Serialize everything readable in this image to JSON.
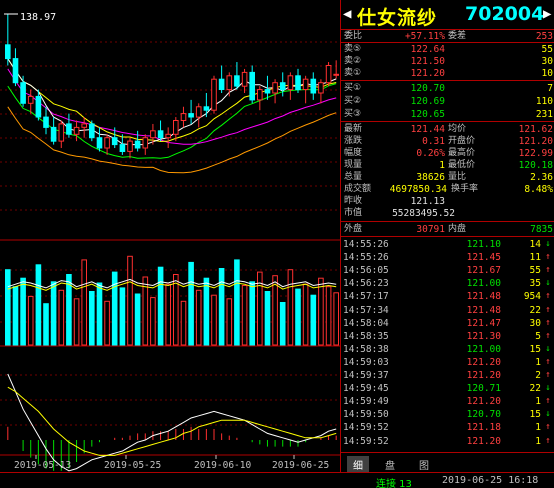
{
  "stock": {
    "name": "仕女流纱",
    "code": "702004"
  },
  "chart": {
    "high_label": "138.97",
    "x_labels": [
      "2019-05-13",
      "2019-05-25",
      "2019-06-10",
      "2019-06-25"
    ],
    "colors": {
      "up": "#ff3030",
      "down": "#00ffff",
      "ma5": "#ffffff",
      "ma10": "#ffff00",
      "ma20": "#ff00ff",
      "ma60": "#00ff00",
      "ma120": "#ff9900"
    }
  },
  "chart_data": {
    "type": "candlestick",
    "x_ticks": [
      "2019-05-13",
      "2019-05-25",
      "2019-06-10",
      "2019-06-25"
    ],
    "high_marker": 138.97,
    "candles": [
      [
        130,
        138.97,
        124,
        126
      ],
      [
        126,
        129,
        118,
        119
      ],
      [
        119,
        121,
        112,
        113
      ],
      [
        113,
        117,
        110,
        115
      ],
      [
        115,
        117,
        108,
        109
      ],
      [
        109,
        112,
        104,
        106
      ],
      [
        106,
        109,
        101,
        102
      ],
      [
        102,
        108,
        100,
        107
      ],
      [
        107,
        110,
        103,
        104
      ],
      [
        104,
        108,
        102,
        106
      ],
      [
        106,
        109,
        103,
        107
      ],
      [
        107,
        108,
        102,
        103
      ],
      [
        103,
        106,
        99,
        100
      ],
      [
        100,
        104,
        98,
        103
      ],
      [
        103,
        106,
        100,
        101
      ],
      [
        101,
        104,
        98,
        99
      ],
      [
        99,
        103,
        97,
        102
      ],
      [
        102,
        105,
        99,
        100
      ],
      [
        100,
        104,
        98,
        103
      ],
      [
        103,
        107,
        101,
        105
      ],
      [
        105,
        108,
        102,
        103
      ],
      [
        103,
        106,
        100,
        104
      ],
      [
        104,
        109,
        102,
        108
      ],
      [
        108,
        112,
        106,
        110
      ],
      [
        110,
        114,
        107,
        109
      ],
      [
        109,
        113,
        106,
        112
      ],
      [
        112,
        116,
        109,
        111
      ],
      [
        111,
        121,
        110,
        120
      ],
      [
        120,
        124,
        116,
        117
      ],
      [
        117,
        122,
        115,
        121
      ],
      [
        121,
        125,
        117,
        118
      ],
      [
        118,
        123,
        116,
        122
      ],
      [
        122,
        124,
        113,
        114
      ],
      [
        114,
        118,
        111,
        117
      ],
      [
        117,
        121,
        114,
        116
      ],
      [
        116,
        120,
        113,
        119
      ],
      [
        119,
        122,
        115,
        117
      ],
      [
        117,
        122,
        114,
        121
      ],
      [
        121,
        123,
        116,
        117
      ],
      [
        117,
        121,
        113,
        120
      ],
      [
        120,
        122,
        114,
        116
      ],
      [
        116,
        120,
        113,
        119
      ],
      [
        119,
        125,
        118,
        124
      ],
      [
        121.2,
        125.5,
        120.2,
        121.44
      ]
    ],
    "volumes": [
      62,
      48,
      55,
      40,
      66,
      34,
      52,
      45,
      58,
      38,
      70,
      44,
      51,
      36,
      60,
      47,
      73,
      42,
      56,
      39,
      64,
      50,
      58,
      36,
      68,
      45,
      55,
      41,
      63,
      38,
      70,
      49,
      52,
      60,
      44,
      57,
      35,
      62,
      46,
      50,
      41,
      55,
      48,
      43
    ],
    "volume_ma5": [
      48,
      50,
      52,
      51,
      49,
      47,
      50,
      53,
      52,
      48,
      50,
      52,
      49,
      47,
      50,
      52,
      54,
      51,
      50,
      49,
      52,
      51,
      53,
      50,
      52,
      50,
      51,
      49,
      52,
      50,
      53,
      52,
      50,
      51,
      49,
      52,
      48,
      50,
      51,
      52,
      49,
      50,
      51,
      50
    ],
    "macd_dif": [
      30,
      22,
      14,
      8,
      2,
      -4,
      -9,
      -12,
      -14,
      -13,
      -11,
      -9,
      -8,
      -7,
      -6,
      -5,
      -3,
      -1,
      0,
      2,
      3,
      4,
      6,
      8,
      10,
      11,
      12,
      13,
      12,
      11,
      10,
      9,
      7,
      5,
      3,
      2,
      1,
      0,
      -1,
      0,
      1,
      2,
      4,
      5
    ],
    "macd_dea": [
      24,
      22,
      19,
      16,
      13,
      9,
      5,
      2,
      -1,
      -3,
      -5,
      -6,
      -7,
      -7,
      -7,
      -6,
      -5,
      -4,
      -3,
      -2,
      -1,
      0,
      1,
      3,
      4,
      6,
      7,
      8,
      9,
      9,
      9,
      9,
      8,
      7,
      6,
      5,
      4,
      3,
      2,
      1,
      1,
      1,
      2,
      3
    ],
    "macd_bar": [
      6,
      0,
      -5,
      -8,
      -11,
      -13,
      -14,
      -14,
      -13,
      -10,
      -6,
      -3,
      -1,
      0,
      1,
      1,
      2,
      3,
      3,
      4,
      4,
      4,
      5,
      5,
      6,
      5,
      5,
      5,
      3,
      2,
      1,
      0,
      -1,
      -2,
      -3,
      -3,
      -3,
      -3,
      -3,
      -1,
      0,
      1,
      2,
      2
    ]
  },
  "quote": {
    "weibi_label": "委比",
    "weibi": "+57.11%",
    "weicha_label": "委差",
    "weicha": "253",
    "sells": [
      {
        "label": "卖⑤",
        "price": "122.64",
        "vol": "55"
      },
      {
        "label": "卖②",
        "price": "121.50",
        "vol": "30"
      },
      {
        "label": "卖①",
        "price": "121.20",
        "vol": "10"
      }
    ],
    "buys": [
      {
        "label": "买①",
        "price": "120.70",
        "vol": "7"
      },
      {
        "label": "买②",
        "price": "120.69",
        "vol": "110"
      },
      {
        "label": "买③",
        "price": "120.65",
        "vol": "231"
      }
    ],
    "stats": {
      "latest_label": "最新",
      "latest": "121.44",
      "avg_label": "均价",
      "avg": "121.62",
      "change_label": "涨跌",
      "change": "0.31",
      "open_label": "开盘价",
      "open": "121.20",
      "pct_label": "幅度",
      "pct": "0.26%",
      "high_label": "最高价",
      "high": "122.99",
      "now_vol_label": "现量",
      "now_vol": "1",
      "low_label": "最低价",
      "low": "120.18",
      "total_vol_label": "总量",
      "total_vol": "38626",
      "ratio_label": "量比",
      "ratio": "2.36",
      "amount_label": "成交额",
      "amount": "4697850.34",
      "turnover_label": "换手率",
      "turnover": "8.48%",
      "prev_label": "昨收",
      "prev": "121.13",
      "mcap_label": "市值",
      "mcap": "55283495.52",
      "outer_label": "外盘",
      "outer": "30791",
      "inner_label": "内盘",
      "inner": "7835"
    }
  },
  "ticks": [
    {
      "time": "14:55:26",
      "price": "121.10",
      "vol": "14",
      "dir": "down"
    },
    {
      "time": "14:55:26",
      "price": "121.45",
      "vol": "11",
      "dir": "up"
    },
    {
      "time": "14:56:05",
      "price": "121.67",
      "vol": "55",
      "dir": "up"
    },
    {
      "time": "14:56:23",
      "price": "121.00",
      "vol": "35",
      "dir": "down"
    },
    {
      "time": "14:57:17",
      "price": "121.48",
      "vol": "954",
      "dir": "up"
    },
    {
      "time": "14:57:34",
      "price": "121.48",
      "vol": "22",
      "dir": "up"
    },
    {
      "time": "14:58:04",
      "price": "121.47",
      "vol": "30",
      "dir": "up"
    },
    {
      "time": "14:58:35",
      "price": "121.30",
      "vol": "5",
      "dir": "up"
    },
    {
      "time": "14:58:38",
      "price": "121.00",
      "vol": "15",
      "dir": "down"
    },
    {
      "time": "14:59:03",
      "price": "121.20",
      "vol": "1",
      "dir": "up"
    },
    {
      "time": "14:59:37",
      "price": "121.20",
      "vol": "2",
      "dir": "up"
    },
    {
      "time": "14:59:45",
      "price": "120.71",
      "vol": "22",
      "dir": "down"
    },
    {
      "time": "14:59:49",
      "price": "121.20",
      "vol": "1",
      "dir": "up"
    },
    {
      "time": "14:59:50",
      "price": "120.70",
      "vol": "15",
      "dir": "down"
    },
    {
      "time": "14:59:52",
      "price": "121.18",
      "vol": "1",
      "dir": "up"
    },
    {
      "time": "14:59:52",
      "price": "121.20",
      "vol": "1",
      "dir": "up"
    }
  ],
  "tabs": [
    "细",
    "盘",
    "图"
  ],
  "status": {
    "connection": "连接 13",
    "datetime": "2019-06-25 16:18"
  }
}
